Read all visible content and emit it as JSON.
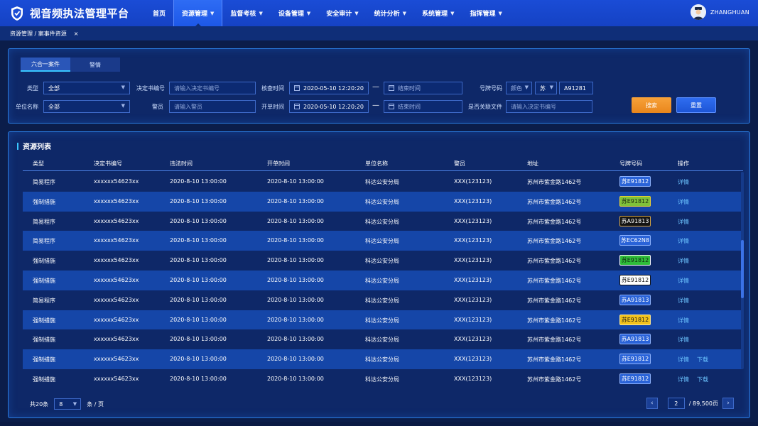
{
  "app": {
    "title": "视音频执法管理平台",
    "user": "ZHANGHUAN"
  },
  "nav": [
    {
      "label": "首页",
      "caret": false,
      "active": false
    },
    {
      "label": "资源管理",
      "caret": true,
      "active": true
    },
    {
      "label": "监督考核",
      "caret": true,
      "active": false
    },
    {
      "label": "设备管理",
      "caret": true,
      "active": false
    },
    {
      "label": "安全审计",
      "caret": true,
      "active": false
    },
    {
      "label": "统计分析",
      "caret": true,
      "active": false
    },
    {
      "label": "系统管理",
      "caret": true,
      "active": false
    },
    {
      "label": "指挥管理",
      "caret": true,
      "active": false
    }
  ],
  "breadcrumb": {
    "text": "资源管理 / 案事件资源",
    "close": "×"
  },
  "tabs": [
    {
      "label": "六合一案件",
      "active": true
    },
    {
      "label": "警情",
      "active": false
    }
  ],
  "filters": {
    "type_label": "类型",
    "type_value": "全部",
    "decision_label": "决定书编号",
    "decision_placeholder": "请输入决定书编号",
    "check_time_label": "核查时间",
    "check_time_start": "2020-05-10  12:20:20",
    "check_time_end_placeholder": "结束时间",
    "plate_label": "号牌号码",
    "plate_color": "颜色",
    "plate_province": "苏",
    "plate_number": "A91281",
    "unit_label": "单位名称",
    "unit_value": "全部",
    "officer_label": "警员",
    "officer_placeholder": "请输入警员",
    "open_time_label": "开单时间",
    "open_time_start": "2020-05-10  12:20:20",
    "open_time_end_placeholder": "结束时间",
    "linked_label": "是否关联文件",
    "linked_placeholder": "请输入决定书编号",
    "dash": "—",
    "search_button": "搜索",
    "reset_button": "重置"
  },
  "list": {
    "title": "资源列表",
    "columns": [
      "类型",
      "决定书编号",
      "违法时间",
      "开单时间",
      "单位名称",
      "警员",
      "地址",
      "号牌号码",
      "操作"
    ],
    "rows": [
      {
        "type": "简易程序",
        "decision": "xxxxxx54623xx",
        "violation_time": "2020-8-10 13:00:00",
        "open_time": "2020-8-10 13:00:00",
        "unit": "科达公安分局",
        "officer": "XXX(123123)",
        "address": "苏州市紫金路1462号",
        "plate": "苏E91812",
        "plate_bg": "#2a63d8",
        "plate_fg": "#ffffff",
        "plate_border": "#8fb4ff",
        "action": "详情",
        "action2": ""
      },
      {
        "type": "强制措施",
        "decision": "xxxxxx54623xx",
        "violation_time": "2020-8-10 13:00:00",
        "open_time": "2020-8-10 13:00:00",
        "unit": "科达公安分局",
        "officer": "XXX(123123)",
        "address": "苏州市紫金路1462号",
        "plate": "苏E91812",
        "plate_bg": "#7fc23a",
        "plate_fg": "#1a2a10",
        "plate_border": "#f2d430",
        "action": "详情",
        "action2": ""
      },
      {
        "type": "简易程序",
        "decision": "xxxxxx54623xx",
        "violation_time": "2020-8-10 13:00:00",
        "open_time": "2020-8-10 13:00:00",
        "unit": "科达公安分局",
        "officer": "XXX(123123)",
        "address": "苏州市紫金路1462号",
        "plate": "苏A91813",
        "plate_bg": "#141414",
        "plate_fg": "#ffffff",
        "plate_border": "#d9a640",
        "action": "详情",
        "action2": ""
      },
      {
        "type": "简易程序",
        "decision": "xxxxxx54623xx",
        "violation_time": "2020-8-10 13:00:00",
        "open_time": "2020-8-10 13:00:00",
        "unit": "科达公安分局",
        "officer": "XXX(123123)",
        "address": "苏州市紫金路1462号",
        "plate": "苏EC62N8",
        "plate_bg": "#2a63d8",
        "plate_fg": "#ffffff",
        "plate_border": "#8fb4ff",
        "action": "详情",
        "action2": ""
      },
      {
        "type": "强制措施",
        "decision": "xxxxxx54623xx",
        "violation_time": "2020-8-10 13:00:00",
        "open_time": "2020-8-10 13:00:00",
        "unit": "科达公安分局",
        "officer": "XXX(123123)",
        "address": "苏州市紫金路1462号",
        "plate": "苏E91812",
        "plate_bg": "#2fbd3a",
        "plate_fg": "#0f2a10",
        "plate_border": "#ffffff",
        "action": "详情",
        "action2": ""
      },
      {
        "type": "强制措施",
        "decision": "xxxxxx54623xx",
        "violation_time": "2020-8-10 13:00:00",
        "open_time": "2020-8-10 13:00:00",
        "unit": "科达公安分局",
        "officer": "XXX(123123)",
        "address": "苏州市紫金路1462号",
        "plate": "苏E91812",
        "plate_bg": "#ffffff",
        "plate_fg": "#111111",
        "plate_border": "#111111",
        "action": "详情",
        "action2": ""
      },
      {
        "type": "简易程序",
        "decision": "xxxxxx54623xx",
        "violation_time": "2020-8-10 13:00:00",
        "open_time": "2020-8-10 13:00:00",
        "unit": "科达公安分局",
        "officer": "XXX(123123)",
        "address": "苏州市紫金路1462号",
        "plate": "苏A91813",
        "plate_bg": "#2a63d8",
        "plate_fg": "#ffffff",
        "plate_border": "#8fb4ff",
        "action": "详情",
        "action2": ""
      },
      {
        "type": "强制措施",
        "decision": "xxxxxx54623xx",
        "violation_time": "2020-8-10 13:00:00",
        "open_time": "2020-8-10 13:00:00",
        "unit": "科达公安分局",
        "officer": "XXX(123123)",
        "address": "苏州市紫金路1462号",
        "plate": "苏E91812",
        "plate_bg": "#f2c21c",
        "plate_fg": "#1a1a1a",
        "plate_border": "#ffe890",
        "action": "详情",
        "action2": ""
      },
      {
        "type": "强制措施",
        "decision": "xxxxxx54623xx",
        "violation_time": "2020-8-10 13:00:00",
        "open_time": "2020-8-10 13:00:00",
        "unit": "科达公安分局",
        "officer": "XXX(123123)",
        "address": "苏州市紫金路1462号",
        "plate": "苏A91813",
        "plate_bg": "#2a63d8",
        "plate_fg": "#ffffff",
        "plate_border": "#8fb4ff",
        "action": "详情",
        "action2": ""
      },
      {
        "type": "强制措施",
        "decision": "xxxxxx54623xx",
        "violation_time": "2020-8-10 13:00:00",
        "open_time": "2020-8-10 13:00:00",
        "unit": "科达公安分局",
        "officer": "XXX(123123)",
        "address": "苏州市紫金路1462号",
        "plate": "苏E91812",
        "plate_bg": "#2a63d8",
        "plate_fg": "#ffffff",
        "plate_border": "#8fb4ff",
        "action": "详情",
        "action2": "下载"
      },
      {
        "type": "强制措施",
        "decision": "xxxxxx54623xx",
        "violation_time": "2020-8-10 13:00:00",
        "open_time": "2020-8-10 13:00:00",
        "unit": "科达公安分局",
        "officer": "XXX(123123)",
        "address": "苏州市紫金路1462号",
        "plate": "苏E91812",
        "plate_bg": "#2a63d8",
        "plate_fg": "#ffffff",
        "plate_border": "#8fb4ff",
        "action": "详情",
        "action2": "下载"
      }
    ]
  },
  "pager": {
    "total_text": "共20条",
    "page_size": "8",
    "per_page_text": "条 / 页",
    "prev": "‹",
    "next": "›",
    "current": "2",
    "total_pages": "/ 89,500页"
  }
}
